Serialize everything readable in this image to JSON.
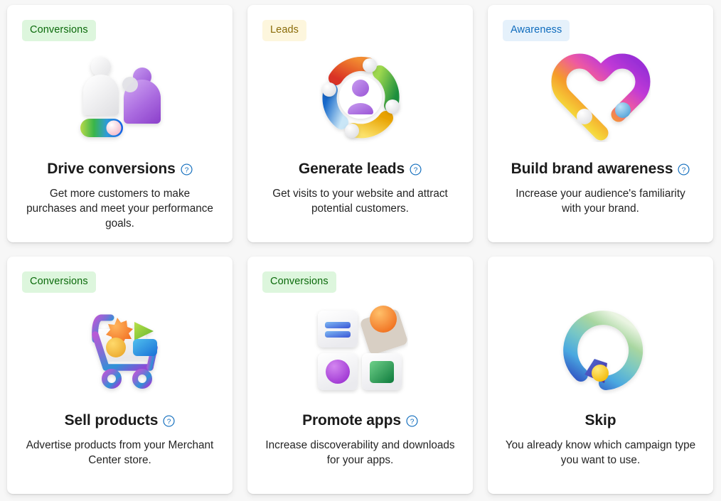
{
  "page": {
    "background_color": "#f7f7f7",
    "card_background": "#ffffff",
    "title_color": "#1b1b1b",
    "description_color": "#242424",
    "help_icon_color": "#0f6cbd"
  },
  "badge_styles": {
    "conversions": {
      "label": "Conversions",
      "background": "#ddf6dd",
      "text_color": "#0b6a0b"
    },
    "leads": {
      "label": "Leads",
      "background": "#fdf6dd",
      "text_color": "#8a6b09"
    },
    "awareness": {
      "label": "Awareness",
      "background": "#e5f1fb",
      "text_color": "#0f6cbd"
    }
  },
  "cards": [
    {
      "badge": "Conversions",
      "badge_kind": "conversions",
      "icon": "two-people-toggle-icon",
      "title": "Drive conversions",
      "help": "help-icon",
      "has_help": true,
      "description": "Get more customers to make purchases and meet your performance goals."
    },
    {
      "badge": "Leads",
      "badge_kind": "leads",
      "icon": "people-ring-icon",
      "title": "Generate leads",
      "help": "help-icon",
      "has_help": true,
      "description": "Get visits to your website and attract potential customers."
    },
    {
      "badge": "Awareness",
      "badge_kind": "awareness",
      "icon": "gradient-heart-icon",
      "title": "Build brand awareness",
      "help": "help-icon",
      "has_help": true,
      "description": "Increase your audience's familiarity with your brand."
    },
    {
      "badge": "Conversions",
      "badge_kind": "conversions",
      "icon": "shopping-cart-icon",
      "title": "Sell products",
      "help": "help-icon",
      "has_help": true,
      "description": "Advertise products from your Merchant Center store."
    },
    {
      "badge": "Conversions",
      "badge_kind": "conversions",
      "icon": "app-tiles-icon",
      "title": "Promote apps",
      "help": "help-icon",
      "has_help": true,
      "description": "Increase discoverability and downloads for your apps."
    },
    {
      "badge": "",
      "badge_kind": "none",
      "icon": "circular-arrow-skip-icon",
      "title": "Skip",
      "help": "",
      "has_help": false,
      "description": "You already know which campaign type you want to use."
    }
  ]
}
